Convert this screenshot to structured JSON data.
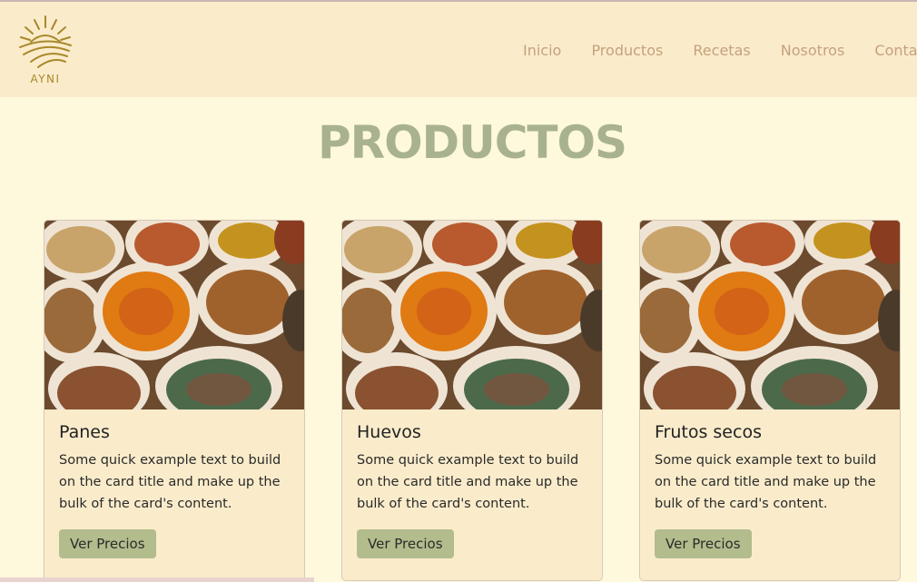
{
  "brand": {
    "logo_text": "AYNI",
    "accent": "#a8882a"
  },
  "nav": {
    "items": [
      {
        "label": "Inicio"
      },
      {
        "label": "Productos"
      },
      {
        "label": "Recetas"
      },
      {
        "label": "Nosotros"
      },
      {
        "label": "Contact"
      }
    ]
  },
  "page": {
    "title": "PRODUCTOS"
  },
  "cards": [
    {
      "title": "Panes",
      "text": "Some quick example text to build on the card title and make up the bulk of the card's content.",
      "button": "Ver Precios"
    },
    {
      "title": "Huevos",
      "text": "Some quick example text to build on the card title and make up the bulk of the card's content.",
      "button": "Ver Precios"
    },
    {
      "title": "Frutos secos",
      "text": "Some quick example text to build on the card title and make up the bulk of the card's content.",
      "button": "Ver Precios"
    }
  ],
  "colors": {
    "background": "#fef8dc",
    "navbar": "#faeccb",
    "nav_text": "#c6a07d",
    "title": "#a9b28e",
    "button": "#b3bc8c"
  }
}
